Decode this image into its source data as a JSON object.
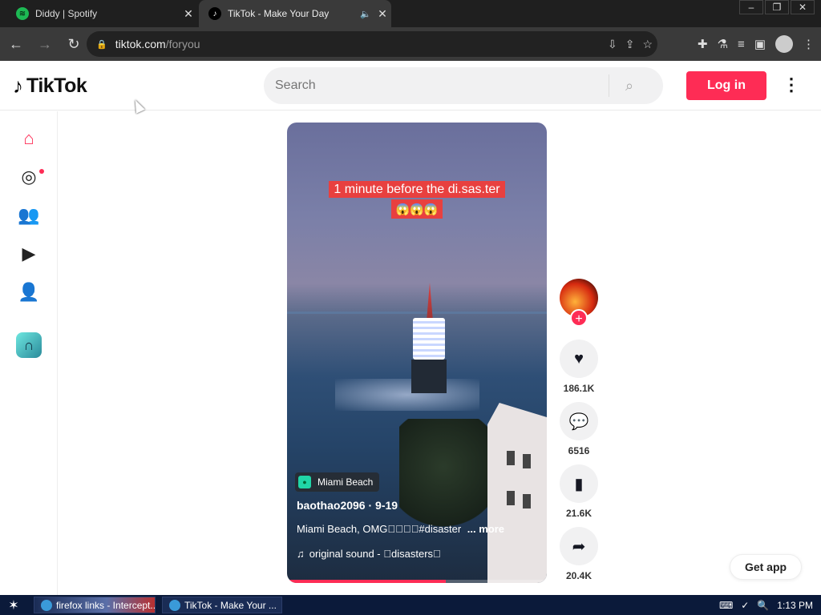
{
  "browser": {
    "tabs": [
      {
        "title": "Diddy | Spotify",
        "favicon": "spotify-icon",
        "active": false
      },
      {
        "title": "TikTok - Make Your Day",
        "favicon": "tiktok-icon",
        "active": true
      }
    ],
    "url_host": "tiktok.com",
    "url_path": "/foryou"
  },
  "header": {
    "logo_text": "TikTok",
    "search_placeholder": "Search",
    "login_label": "Log in"
  },
  "sidenav": {
    "items": [
      "home-icon",
      "explore-icon",
      "following-icon",
      "live-icon",
      "profile-icon",
      "gate-icon"
    ]
  },
  "video": {
    "caption_line1": "1 minute before the di.sas.ter",
    "caption_emojis": "😱😱😱",
    "location": "Miami Beach",
    "author": "baothao2096 · 9-19",
    "description": "Miami Beach, OMG\u0000\u0000\u0000\u0000#disaster",
    "description_more": "... more",
    "sound": "original sound - \u0000disasters\u0000",
    "progress": 0.61
  },
  "actions": {
    "likes": "186.1K",
    "comments": "6516",
    "saves": "21.6K",
    "shares": "20.4K"
  },
  "get_app_label": "Get app",
  "taskbar": {
    "items": [
      "firefox links - Intercept...",
      "TikTok - Make Your ..."
    ],
    "clock": "1:13 PM"
  },
  "colors": {
    "accent": "#fe2c55",
    "caption_bg": "#e8403f"
  }
}
